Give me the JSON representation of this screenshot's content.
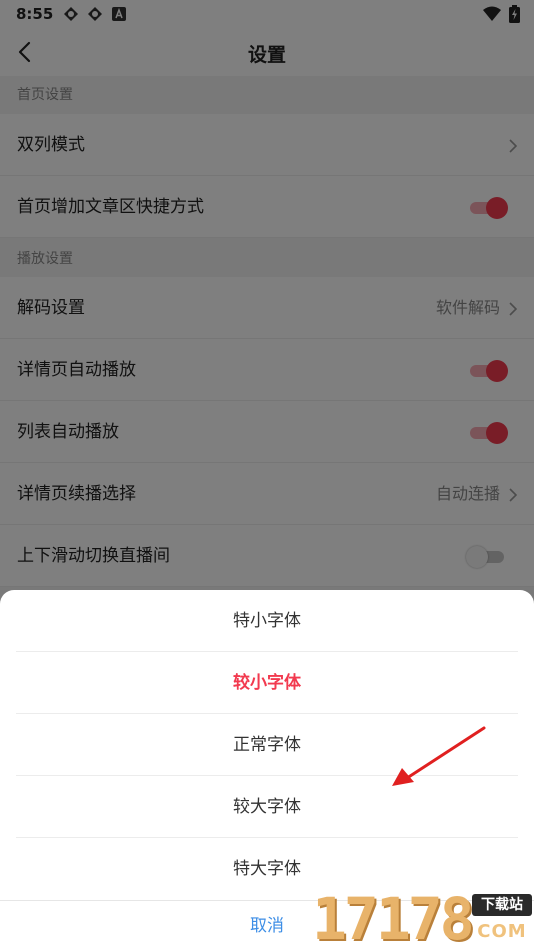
{
  "status_bar": {
    "time": "8:55"
  },
  "nav": {
    "title": "设置"
  },
  "sections": {
    "home": {
      "header": "首页设置",
      "dual_column": "双列模式",
      "add_shortcut": "首页增加文章区快捷方式"
    },
    "playback": {
      "header": "播放设置",
      "decode": "解码设置",
      "decode_value": "软件解码",
      "detail_autoplay": "详情页自动播放",
      "list_autoplay": "列表自动播放",
      "continue_select": "详情页续播选择",
      "continue_value": "自动连播",
      "swipe_switch": "上下滑动切换直播间"
    }
  },
  "toggles": {
    "add_shortcut": true,
    "detail_autoplay": true,
    "list_autoplay": true,
    "swipe_switch": false
  },
  "font_sheet": {
    "options": [
      "特小字体",
      "较小字体",
      "正常字体",
      "较大字体",
      "特大字体"
    ],
    "selected": "较小字体",
    "cancel": "取消"
  },
  "watermark": {
    "number": "17178",
    "badge": "下载站",
    "domain": "COM"
  },
  "colors": {
    "accent": "#f23a4f",
    "cancel": "#3d8ee6",
    "arrow": "#e02020"
  }
}
